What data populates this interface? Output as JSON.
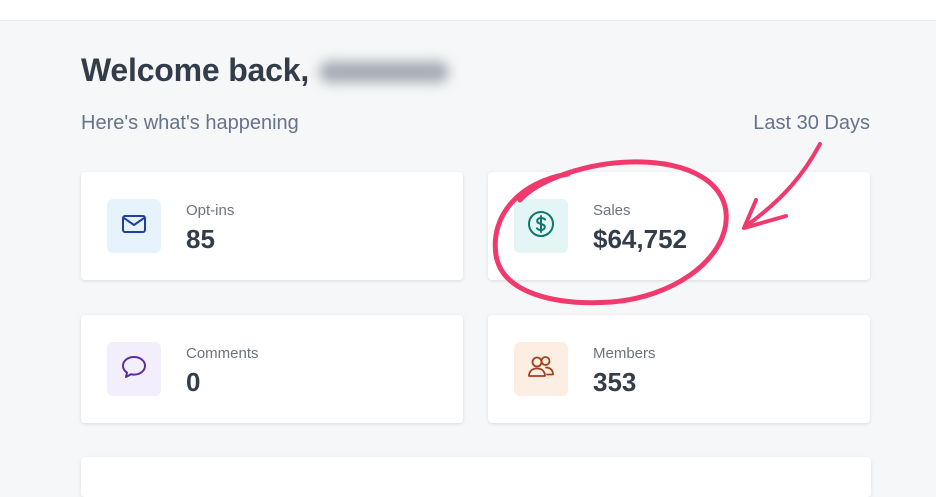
{
  "header": {
    "welcome": "Welcome back,",
    "subtitle": "Here's what's happening",
    "period": "Last 30 Days"
  },
  "stats": {
    "optins": {
      "label": "Opt-ins",
      "value": "85",
      "icon": "mail-icon",
      "tint": "#e6f3fc",
      "color": "#1e3fa8"
    },
    "sales": {
      "label": "Sales",
      "value": "$64,752",
      "icon": "dollar-icon",
      "tint": "#e3f6f5",
      "color": "#0f766e"
    },
    "comments": {
      "label": "Comments",
      "value": "0",
      "icon": "chat-bubble-icon",
      "tint": "#f3eefb",
      "color": "#5b2d9e"
    },
    "members": {
      "label": "Members",
      "value": "353",
      "icon": "users-icon",
      "tint": "#fdeee3",
      "color": "#a2401a"
    }
  },
  "annotation": {
    "color": "#f03a6e"
  }
}
